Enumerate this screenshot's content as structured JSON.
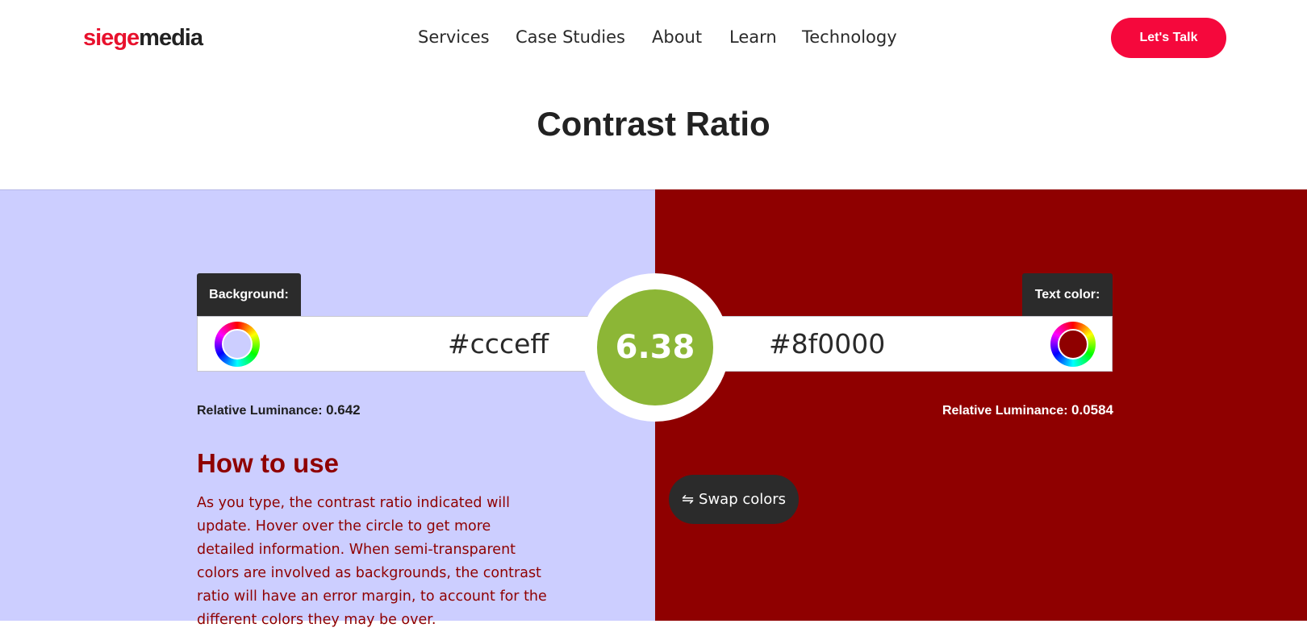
{
  "header": {
    "logo": {
      "part1": "siege",
      "part2": "media"
    },
    "nav": [
      "Services",
      "Case Studies",
      "About",
      "Learn",
      "Technology"
    ],
    "cta_label": "Let's Talk"
  },
  "page": {
    "title": "Contrast Ratio"
  },
  "background": {
    "label": "Background:",
    "value": "#ccceff",
    "luminance_label": "Relative Luminance:",
    "luminance_value": "0.642"
  },
  "text_color": {
    "label": "Text color:",
    "value": "#8f0000",
    "luminance_label": "Relative Luminance:",
    "luminance_value": "0.0584"
  },
  "ratio": {
    "value": "6.38",
    "color": "#8cb636"
  },
  "swap": {
    "icon": "⇋",
    "label": "Swap colors"
  },
  "how_to_use": {
    "title": "How to use",
    "text": "As you type, the contrast ratio indicated will update. Hover over the circle to get more detailed information. When semi-transparent colors are involved as backgrounds, the contrast ratio will have an error margin, to account for the different colors they may be over."
  },
  "colors": {
    "brand": "#e8112d",
    "cta": "#f5083c",
    "background_swatch": "#ccceff",
    "text_swatch": "#8f0000"
  },
  "icons": {
    "color_picker": "color-wheel-icon",
    "swap": "swap-arrows-icon"
  }
}
